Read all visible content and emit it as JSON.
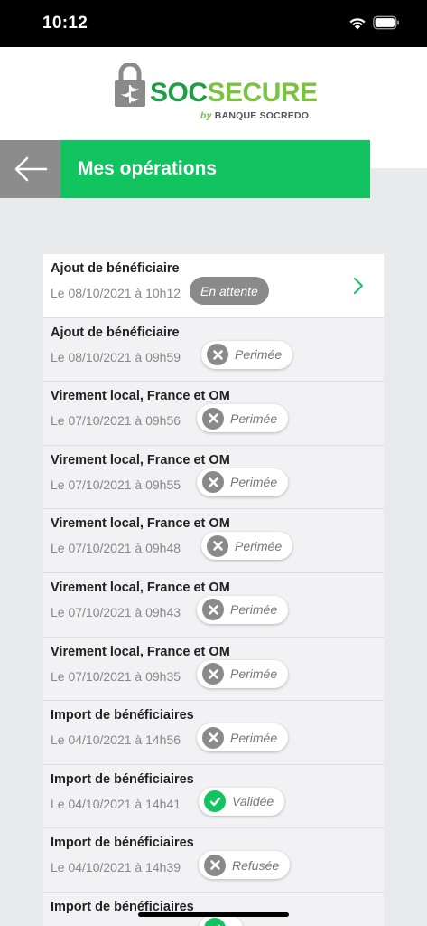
{
  "status": {
    "time": "10:12"
  },
  "logo": {
    "soc": "SOC",
    "secure": "SECURE",
    "by": "by",
    "bank": "BANQUE SOCREDO"
  },
  "header": {
    "title": "Mes opérations"
  },
  "colors": {
    "green": "#12c460",
    "grey": "#8c8c8c",
    "logo_dark_green": "#1f9e46",
    "logo_light_green": "#7cc242"
  },
  "operations": [
    {
      "title": "Ajout de bénéficiaire",
      "date": "Le 08/10/2021 à 10h12",
      "status": "En attente",
      "status_type": "pending"
    },
    {
      "title": "Ajout de bénéficiaire",
      "date": "Le 08/10/2021 à 09h59",
      "status": "Perimée",
      "status_type": "expired"
    },
    {
      "title": "Virement local, France et OM",
      "date": "Le 07/10/2021 à 09h56",
      "status": "Perimée",
      "status_type": "expired"
    },
    {
      "title": "Virement local, France et OM",
      "date": "Le 07/10/2021 à 09h55",
      "status": "Perimée",
      "status_type": "expired"
    },
    {
      "title": "Virement local, France et OM",
      "date": "Le 07/10/2021 à 09h48",
      "status": "Perimée",
      "status_type": "expired"
    },
    {
      "title": "Virement local, France et OM",
      "date": "Le 07/10/2021 à 09h43",
      "status": "Perimée",
      "status_type": "expired"
    },
    {
      "title": "Virement local, France et OM",
      "date": "Le 07/10/2021 à 09h35",
      "status": "Perimée",
      "status_type": "expired"
    },
    {
      "title": "Import de bénéficiaires",
      "date": "Le 04/10/2021 à 14h56",
      "status": "Perimée",
      "status_type": "expired"
    },
    {
      "title": "Import de bénéficiaires",
      "date": "Le 04/10/2021 à 14h41",
      "status": "Validée",
      "status_type": "validated"
    },
    {
      "title": "Import de bénéficiaires",
      "date": "Le 04/10/2021 à 14h39",
      "status": "Refusée",
      "status_type": "refused"
    },
    {
      "title": "Import de bénéficiaires",
      "date": "",
      "status": "",
      "status_type": "validated"
    }
  ]
}
